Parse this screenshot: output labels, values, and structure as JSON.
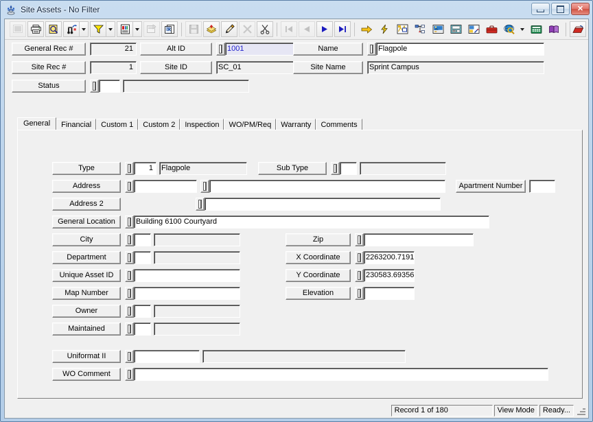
{
  "window": {
    "title": "Site Assets - No Filter",
    "icon": "site-assets-icon",
    "minimize_label": "",
    "maximize_label": "",
    "close_label": "✕"
  },
  "toolbar": {
    "groups": [
      {
        "buttons": [
          {
            "name": "select-grid-icon",
            "label": "",
            "disabled": true,
            "dropdown": false
          },
          {
            "name": "print-icon",
            "label": "",
            "disabled": false,
            "dropdown": false
          },
          {
            "name": "print-preview-icon",
            "label": "",
            "disabled": false,
            "dropdown": false
          },
          {
            "name": "find-icon",
            "label": "",
            "disabled": false,
            "dropdown": true
          },
          {
            "name": "filter-icon",
            "label": "",
            "disabled": false,
            "dropdown": true
          },
          {
            "name": "report-icon",
            "label": "",
            "disabled": false,
            "dropdown": true
          },
          {
            "name": "properties-icon",
            "label": "",
            "disabled": true,
            "dropdown": false
          },
          {
            "name": "copy-record-icon",
            "label": "",
            "disabled": false,
            "dropdown": false
          }
        ]
      },
      {
        "buttons": [
          {
            "name": "save-icon",
            "label": "",
            "disabled": true,
            "dropdown": false
          },
          {
            "name": "new-record-icon",
            "label": "",
            "disabled": false,
            "dropdown": false
          },
          {
            "name": "edit-icon",
            "label": "",
            "disabled": false,
            "dropdown": false
          },
          {
            "name": "delete-icon",
            "label": "",
            "disabled": true,
            "dropdown": false
          },
          {
            "name": "cut-icon",
            "label": "",
            "disabled": false,
            "dropdown": false
          }
        ]
      },
      {
        "buttons": [
          {
            "name": "first-record-icon",
            "label": "",
            "disabled": true,
            "dropdown": false
          },
          {
            "name": "previous-record-icon",
            "label": "",
            "disabled": true,
            "dropdown": false
          },
          {
            "name": "next-record-icon",
            "label": "",
            "disabled": false,
            "dropdown": false
          },
          {
            "name": "last-record-icon",
            "label": "",
            "disabled": false,
            "dropdown": false
          }
        ]
      },
      {
        "buttons": [
          {
            "name": "goto-icon",
            "label": "",
            "disabled": false,
            "dropdown": false
          },
          {
            "name": "quick-action-icon",
            "label": "",
            "disabled": false,
            "dropdown": false
          },
          {
            "name": "map-view-icon",
            "label": "",
            "disabled": false,
            "dropdown": false
          },
          {
            "name": "tree-view-icon",
            "label": "",
            "disabled": false,
            "dropdown": false
          },
          {
            "name": "image-view-icon",
            "label": "",
            "disabled": false,
            "dropdown": false
          },
          {
            "name": "fax-icon",
            "label": "",
            "disabled": false,
            "dropdown": false
          },
          {
            "name": "drawing-icon",
            "label": "",
            "disabled": false,
            "dropdown": false
          },
          {
            "name": "toolbox-icon",
            "label": "",
            "disabled": false,
            "dropdown": false
          },
          {
            "name": "web-search-icon",
            "label": "",
            "disabled": false,
            "dropdown": true
          },
          {
            "name": "calculator-icon",
            "label": "",
            "disabled": false,
            "dropdown": false
          },
          {
            "name": "help-book-icon",
            "label": "",
            "disabled": false,
            "dropdown": false
          }
        ]
      },
      {
        "buttons": [
          {
            "name": "exit-icon",
            "label": "",
            "disabled": false,
            "dropdown": false
          }
        ]
      }
    ]
  },
  "header": {
    "general_rec_label": "General Rec #",
    "general_rec_value": "21",
    "site_rec_label": "Site Rec #",
    "site_rec_value": "1",
    "status_label": "Status",
    "status_code": "",
    "status_desc": "",
    "alt_id_label": "Alt ID",
    "alt_id_value": "1001",
    "site_id_label": "Site ID",
    "site_id_value": "SC_01",
    "name_label": "Name",
    "name_value": "Flagpole",
    "site_name_label": "Site Name",
    "site_name_value": "Sprint Campus"
  },
  "tabs": [
    {
      "label": "General",
      "active": true
    },
    {
      "label": "Financial",
      "active": false
    },
    {
      "label": "Custom 1",
      "active": false
    },
    {
      "label": "Custom 2",
      "active": false
    },
    {
      "label": "Inspection",
      "active": false
    },
    {
      "label": "WO/PM/Req",
      "active": false
    },
    {
      "label": "Warranty",
      "active": false
    },
    {
      "label": "Comments",
      "active": false
    }
  ],
  "general_tab": {
    "type_label": "Type",
    "type_code": "1",
    "type_desc": "Flagpole",
    "sub_type_label": "Sub Type",
    "sub_type_code": "",
    "sub_type_desc": "",
    "address_label": "Address",
    "address_code": "",
    "address_value": "",
    "address2_label": "Address 2",
    "address2_value": "",
    "apartment_number_label": "Apartment Number",
    "apartment_number_value": "",
    "general_location_label": "General Location",
    "general_location_value": "Building 6100 Courtyard",
    "city_label": "City",
    "city_code": "",
    "city_desc": "",
    "department_label": "Department",
    "department_code": "",
    "department_desc": "",
    "unique_asset_id_label": "Unique Asset ID",
    "unique_asset_id_value": "",
    "map_number_label": "Map Number",
    "map_number_value": "",
    "owner_label": "Owner",
    "owner_code": "",
    "owner_desc": "",
    "maintained_label": "Maintained",
    "maintained_code": "",
    "maintained_desc": "",
    "zip_label": "Zip",
    "zip_value": "",
    "x_coordinate_label": "X Coordinate",
    "x_coordinate_value": "2263200.7191",
    "y_coordinate_label": "Y Coordinate",
    "y_coordinate_value": "230583.69356",
    "elevation_label": "Elevation",
    "elevation_value": "",
    "uniformat_label": "Uniformat II",
    "uniformat_code": "",
    "uniformat_desc": "",
    "wo_comment_label": "WO Comment",
    "wo_comment_value": ""
  },
  "statusbar": {
    "record_text": "Record 1 of 180",
    "mode_text": "View Mode",
    "ready_text": "Ready...",
    "resize_grip": "resize-grip-icon"
  },
  "colors": {
    "window_frame": "#b3cde8",
    "client_bg": "#f0f0f0",
    "focus_field_bg": "#e6e6f4",
    "focus_field_text": "#2222cc",
    "close_button": "#cf5243"
  }
}
